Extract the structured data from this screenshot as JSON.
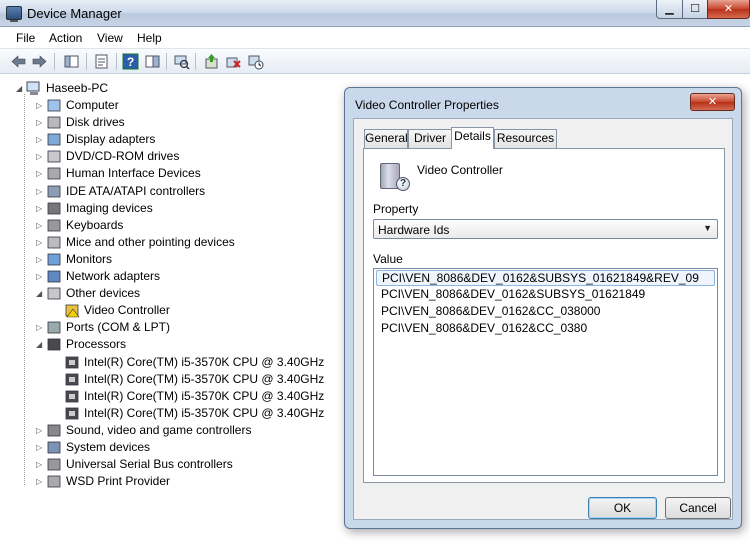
{
  "window": {
    "title": "Device Manager",
    "min_label": "▁",
    "max_label": "☐",
    "close_label": "✕"
  },
  "menu": [
    "File",
    "Action",
    "View",
    "Help"
  ],
  "tree": {
    "root": "Haseeb-PC",
    "items": [
      {
        "label": "Computer",
        "expander": "▷",
        "icon": "computer-icon"
      },
      {
        "label": "Disk drives",
        "expander": "▷",
        "icon": "disk-icon"
      },
      {
        "label": "Display adapters",
        "expander": "▷",
        "icon": "display-icon"
      },
      {
        "label": "DVD/CD-ROM drives",
        "expander": "▷",
        "icon": "dvd-icon"
      },
      {
        "label": "Human Interface Devices",
        "expander": "▷",
        "icon": "hid-icon"
      },
      {
        "label": "IDE ATA/ATAPI controllers",
        "expander": "▷",
        "icon": "ide-icon"
      },
      {
        "label": "Imaging devices",
        "expander": "▷",
        "icon": "camera-icon"
      },
      {
        "label": "Keyboards",
        "expander": "▷",
        "icon": "keyboard-icon"
      },
      {
        "label": "Mice and other pointing devices",
        "expander": "▷",
        "icon": "mouse-icon"
      },
      {
        "label": "Monitors",
        "expander": "▷",
        "icon": "monitor-icon"
      },
      {
        "label": "Network adapters",
        "expander": "▷",
        "icon": "network-icon"
      },
      {
        "label": "Other devices",
        "expander": "◢",
        "icon": "unknown-device-icon"
      },
      {
        "label": "Video Controller",
        "child": true,
        "icon": "warning-device-icon"
      },
      {
        "label": "Ports (COM & LPT)",
        "expander": "▷",
        "icon": "port-icon"
      },
      {
        "label": "Processors",
        "expander": "◢",
        "icon": "cpu-icon"
      },
      {
        "label": "Intel(R) Core(TM) i5-3570K CPU @ 3.40GHz",
        "child": true,
        "icon": "cpu-icon"
      },
      {
        "label": "Intel(R) Core(TM) i5-3570K CPU @ 3.40GHz",
        "child": true,
        "icon": "cpu-icon"
      },
      {
        "label": "Intel(R) Core(TM) i5-3570K CPU @ 3.40GHz",
        "child": true,
        "icon": "cpu-icon"
      },
      {
        "label": "Intel(R) Core(TM) i5-3570K CPU @ 3.40GHz",
        "child": true,
        "icon": "cpu-icon"
      },
      {
        "label": "Sound, video and game controllers",
        "expander": "▷",
        "icon": "speaker-icon"
      },
      {
        "label": "System devices",
        "expander": "▷",
        "icon": "system-icon"
      },
      {
        "label": "Universal Serial Bus controllers",
        "expander": "▷",
        "icon": "usb-icon"
      },
      {
        "label": "WSD Print Provider",
        "expander": "▷",
        "icon": "printer-icon"
      }
    ]
  },
  "dialog": {
    "title": "Video Controller Properties",
    "close_label": "✕",
    "tabs": [
      "General",
      "Driver",
      "Details",
      "Resources"
    ],
    "active_tab": "Details",
    "device_name": "Video Controller",
    "property_label": "Property",
    "property_value": "Hardware Ids",
    "value_label": "Value",
    "values": [
      "PCI\\VEN_8086&DEV_0162&SUBSYS_01621849&REV_09",
      "PCI\\VEN_8086&DEV_0162&SUBSYS_01621849",
      "PCI\\VEN_8086&DEV_0162&CC_038000",
      "PCI\\VEN_8086&DEV_0162&CC_0380"
    ],
    "ok_label": "OK",
    "cancel_label": "Cancel"
  },
  "colors": {
    "dialog_frame": "#c9d8ea",
    "close_red": "#c8452c",
    "selection": "#eef5fd"
  }
}
